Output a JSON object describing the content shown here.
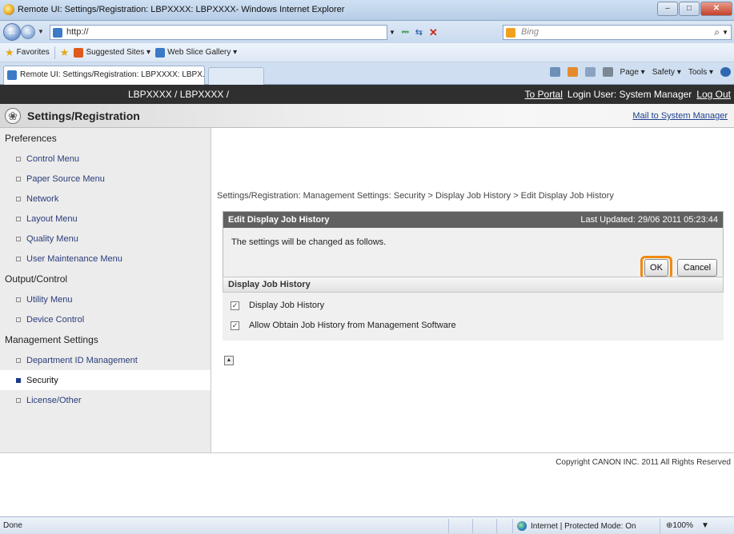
{
  "window": {
    "title": "Remote UI: Settings/Registration: LBPXXXX: LBPXXXX- Windows Internet Explorer",
    "buttons": {
      "minimize": "–",
      "maximize": "□",
      "close": "✕"
    }
  },
  "address": {
    "url": "http://",
    "search_placeholder": "Bing",
    "search_glyph": "⌕"
  },
  "favorites": {
    "label": "Favorites",
    "items": [
      "Suggested Sites ▾",
      "Web Slice Gallery ▾"
    ]
  },
  "tabs": {
    "active": "Remote UI: Settings/Registration: LBPXXXX: LBPX..."
  },
  "commandbar": {
    "page": "Page ▾",
    "safety": "Safety ▾",
    "tools": "Tools ▾"
  },
  "header": {
    "device": "LBPXXXX / LBPXXXX /",
    "to_portal": "To Portal",
    "login_user": "Login User: System Manager",
    "logout": "Log Out",
    "section_title": "Settings/Registration",
    "mail_link": "Mail to System Manager"
  },
  "sidebar": {
    "groups": [
      {
        "title": "Preferences",
        "items": [
          "Control Menu",
          "Paper Source Menu",
          "Network",
          "Layout Menu",
          "Quality Menu",
          "User Maintenance Menu"
        ]
      },
      {
        "title": "Output/Control",
        "items": [
          "Utility Menu",
          "Device Control"
        ]
      },
      {
        "title": "Management Settings",
        "items": [
          "Department ID Management",
          "Security",
          "License/Other"
        ]
      }
    ],
    "active_item": "Security"
  },
  "main": {
    "breadcrumb": "Settings/Registration: Management Settings: Security > Display Job History > Edit Display Job History",
    "panel": {
      "title": "Edit Display Job History",
      "last_updated": "Last Updated: 29/06 2011 05:23:44",
      "message": "The settings will be changed as follows.",
      "ok_label": "OK",
      "cancel_label": "Cancel"
    },
    "section": {
      "title": "Display Job History",
      "options": [
        {
          "label": "Display Job History",
          "checked": true
        },
        {
          "label": "Allow Obtain Job History from Management Software",
          "checked": true
        }
      ]
    }
  },
  "footer": {
    "copyright": "Copyright CANON INC. 2011 All Rights Reserved"
  },
  "status": {
    "left": "Done",
    "zone": "Internet | Protected Mode: On",
    "zoom": "⊕100%"
  }
}
